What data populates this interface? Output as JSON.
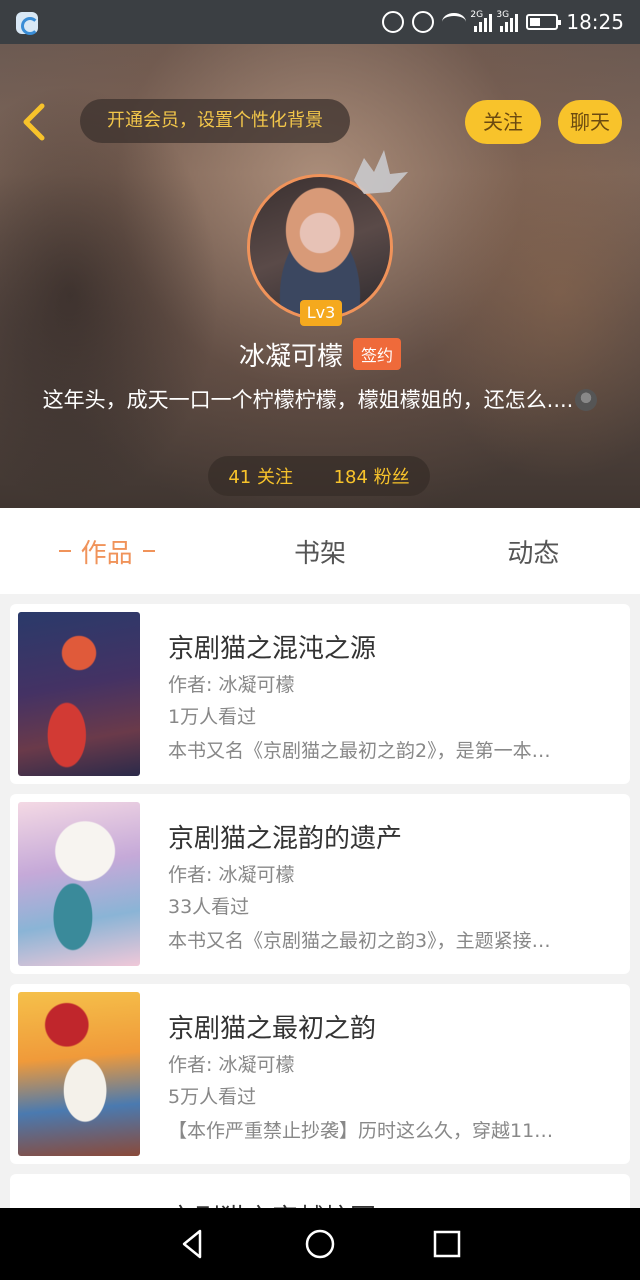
{
  "status_bar": {
    "time": "18:25",
    "network_1": "2G",
    "network_2": "3G"
  },
  "header": {
    "vip_banner": "开通会员，设置个性化背景",
    "follow_label": "关注",
    "chat_label": "聊天",
    "level": "Lv3",
    "username": "冰凝可檬",
    "contract_badge": "签约",
    "bio": "这年头，成天一口一个柠檬柠檬，檬姐檬姐的，还怎么....",
    "following": "41 关注",
    "followers": "184 粉丝"
  },
  "tabs": [
    {
      "label": "作品",
      "active": true
    },
    {
      "label": "书架",
      "active": false
    },
    {
      "label": "动态",
      "active": false
    }
  ],
  "books": [
    {
      "title": "京剧猫之混沌之源",
      "author": "作者: 冰凝可檬",
      "views": "1万人看过",
      "description": "本书又名《京剧猫之最初之韵2》，是第一本…"
    },
    {
      "title": "京剧猫之混韵的遗产",
      "author": "作者: 冰凝可檬",
      "views": "33人看过",
      "description": "本书又名《京剧猫之最初之韵3》，主题紧接…"
    },
    {
      "title": "京剧猫之最初之韵",
      "author": "作者: 冰凝可檬",
      "views": "5万人看过",
      "description": "【本作严重禁止抄袭】历时这么久，穿越11…"
    },
    {
      "title": "京剧猫之穿越校园"
    }
  ],
  "colors": {
    "accent": "#f0935a",
    "pill_yellow": "#f8c32b",
    "contract_orange": "#ef6a3a"
  }
}
